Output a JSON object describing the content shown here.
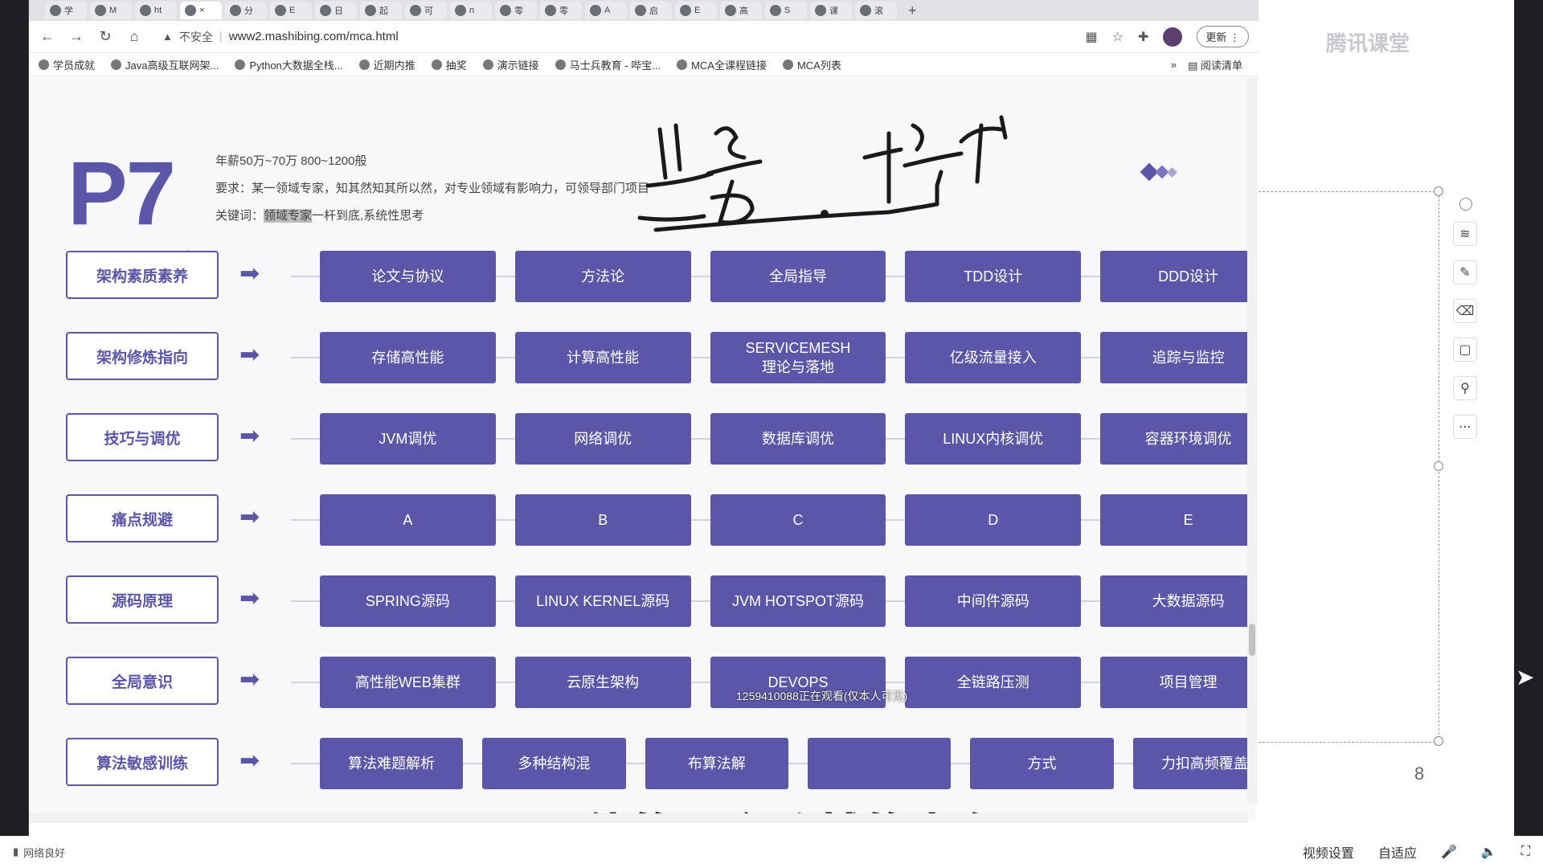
{
  "browser": {
    "tabs": [
      {
        "label": "学"
      },
      {
        "label": "M"
      },
      {
        "label": "ht"
      },
      {
        "label": "×",
        "active": true
      },
      {
        "label": "分"
      },
      {
        "label": "E"
      },
      {
        "label": "日"
      },
      {
        "label": "起"
      },
      {
        "label": "可"
      },
      {
        "label": "n"
      },
      {
        "label": "零"
      },
      {
        "label": "零"
      },
      {
        "label": "A"
      },
      {
        "label": "启"
      },
      {
        "label": "E"
      },
      {
        "label": "高"
      },
      {
        "label": "S"
      },
      {
        "label": "课"
      },
      {
        "label": "滚"
      }
    ],
    "new_tab": "+",
    "nav": {
      "back": "←",
      "forward": "→",
      "reload": "↻",
      "home": "⌂"
    },
    "insecure_label": "不安全",
    "url": "www2.mashibing.com/mca.html",
    "update_label": "更新",
    "bookmarks": [
      "学员成就",
      "Java高级互联网架...",
      "Python大数据全栈...",
      "近期内推",
      "抽奖",
      "演示链接",
      "马士兵教育 - 哔宝...",
      "MCA全课程链接",
      "MCA列表"
    ],
    "bookmarks_more": "»",
    "reading_list": "阅读清单"
  },
  "slide": {
    "level": "P7",
    "salary": "年薪50万~70万 800~1200般",
    "requirement": "要求：某一领域专家，知其然知其所以然，对专业领域有影响力，可领导部门项目",
    "keywords_label": "关键词：",
    "keywords_highlight": "领域专家",
    "keywords_rest": "一杆到底,系统性思考",
    "rows": [
      {
        "label": "架构素质素养",
        "cells": [
          "论文与协议",
          "方法论",
          "全局指导",
          "TDD设计",
          "DDD设计"
        ]
      },
      {
        "label": "架构修炼指向",
        "cells": [
          "存储高性能",
          "计算高性能",
          "SERVICEMESH\n理论与落地",
          "亿级流量接入",
          "追踪与监控"
        ]
      },
      {
        "label": "技巧与调优",
        "cells": [
          "JVM调优",
          "网络调优",
          "数据库调优",
          "LINUX内核调优",
          "容器环境调优"
        ]
      },
      {
        "label": "痛点规避",
        "cells": [
          "A",
          "B",
          "C",
          "D",
          "E"
        ]
      },
      {
        "label": "源码原理",
        "cells": [
          "SPRING源码",
          "LINUX KERNEL源码",
          "JVM HOTSPOT源码",
          "中间件源码",
          "大数据源码"
        ]
      },
      {
        "label": "全局意识",
        "cells": [
          "高性能WEB集群",
          "云原生架构",
          "DEVOPS",
          "全链路压测",
          "项目管理"
        ]
      },
      {
        "label": "算法敏感训练",
        "cells": [
          "算法难题解析",
          "多种结构混",
          "布算法解",
          "",
          "方式",
          "力扣高频覆盖"
        ]
      }
    ]
  },
  "watermark": "1259410088正在观看(仅本人可见)",
  "subtitle": "他的一个跨越的点在哪",
  "right_panel": {
    "logo": "腾讯课堂",
    "page_number": "8",
    "tools": [
      "layers-icon",
      "pen-icon",
      "eraser-icon",
      "frame-icon",
      "pin-icon",
      "more-icon"
    ]
  },
  "bottombar": {
    "network": "网络良好",
    "video_settings": "视频设置",
    "adaptive": "自适应",
    "mic": "🎤",
    "volume": "🔈",
    "fullscreen": "⛶"
  },
  "colors": {
    "accent": "#5b56a8",
    "label_bg": "#ffffff"
  }
}
